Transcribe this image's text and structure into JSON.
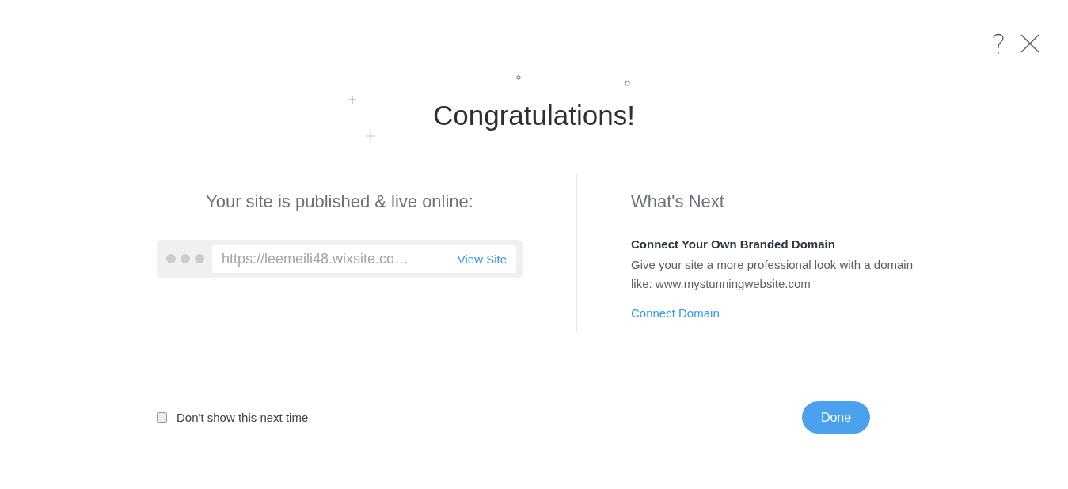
{
  "title": "Congratulations!",
  "published": {
    "heading": "Your site is published & live online:",
    "url": "https://leemeili48.wixsite.co…",
    "view_link": "View Site"
  },
  "next": {
    "heading": "What's Next",
    "item_title": "Connect Your Own Branded Domain",
    "description": "Give your site a more professional look with a domain like: www.mystunningwebsite.com",
    "link": "Connect Domain"
  },
  "footer": {
    "checkbox": {
      "label": "Don't show this next time",
      "checked": false
    },
    "button": "Done"
  }
}
